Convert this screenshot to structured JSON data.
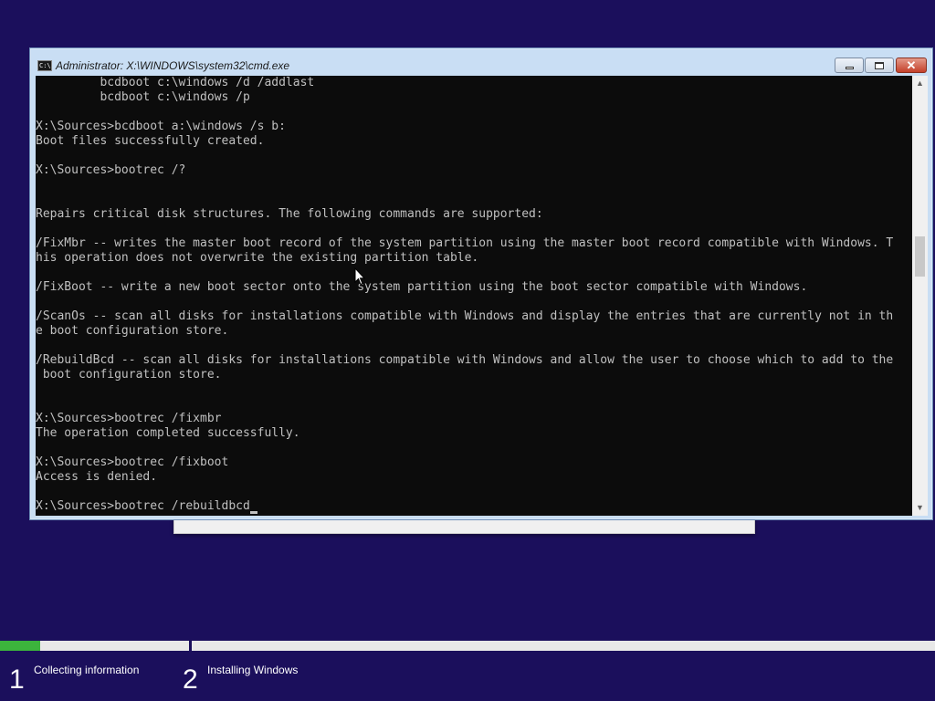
{
  "window": {
    "title": "Administrator: X:\\WINDOWS\\system32\\cmd.exe",
    "icon_label": "C:\\",
    "minimize_icon": "minimize-icon",
    "maximize_icon": "maximize-icon",
    "close_glyph": "✕"
  },
  "console": {
    "lines": [
      "         bcdboot c:\\windows /d /addlast",
      "         bcdboot c:\\windows /p",
      "",
      "X:\\Sources>bcdboot a:\\windows /s b:",
      "Boot files successfully created.",
      "",
      "X:\\Sources>bootrec /?",
      "",
      "",
      "Repairs critical disk structures. The following commands are supported:",
      "",
      "/FixMbr -- writes the master boot record of the system partition using the master boot record compatible with Windows. T",
      "his operation does not overwrite the existing partition table.",
      "",
      "/FixBoot -- write a new boot sector onto the system partition using the boot sector compatible with Windows.",
      "",
      "/ScanOs -- scan all disks for installations compatible with Windows and display the entries that are currently not in th",
      "e boot configuration store.",
      "",
      "/RebuildBcd -- scan all disks for installations compatible with Windows and allow the user to choose which to add to the",
      " boot configuration store.",
      "",
      "",
      "X:\\Sources>bootrec /fixmbr",
      "The operation completed successfully.",
      "",
      "X:\\Sources>bootrec /fixboot",
      "Access is denied.",
      ""
    ],
    "prompt_line": "X:\\Sources>bootrec /rebuildbcd",
    "text_color": "#c0c0c0",
    "background": "#0c0c0c"
  },
  "scrollbar": {
    "up_icon": "▲",
    "down_icon": "▼"
  },
  "setup": {
    "progress_fraction": 0.043,
    "progress_color": "#3cb43c",
    "background": "#1b0f5c",
    "steps": [
      {
        "number": "1",
        "label": "Collecting information"
      },
      {
        "number": "2",
        "label": "Installing Windows"
      }
    ]
  }
}
